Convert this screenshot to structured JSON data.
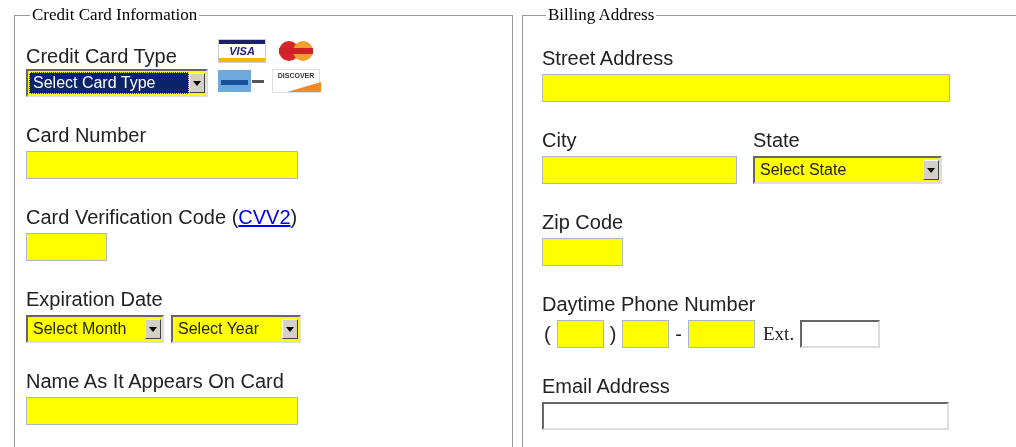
{
  "credit_card": {
    "legend": "Credit Card Information",
    "card_type": {
      "label": "Credit Card Type",
      "select": {
        "value": "Select Card Type",
        "focused": true,
        "highlighted": true
      },
      "logos": [
        {
          "kind": "visa",
          "text": "VISA"
        },
        {
          "kind": "mastercard"
        },
        {
          "kind": "amex"
        },
        {
          "kind": "discover",
          "text": "DISCOVER"
        }
      ]
    },
    "card_number": {
      "label": "Card Number",
      "highlighted": true
    },
    "cvv": {
      "label_before": "Card Verification Code (",
      "link": "CVV2",
      "label_after": ")",
      "highlighted": true
    },
    "expiration": {
      "label": "Expiration Date",
      "selects": [
        {
          "value": "Select Month",
          "focused": false,
          "highlighted": true
        },
        {
          "value": "Select Year",
          "focused": false,
          "highlighted": true
        }
      ]
    },
    "name_on_card": {
      "label": "Name As It Appears On Card",
      "highlighted": true
    }
  },
  "billing_address": {
    "legend": "Billing Address",
    "street": {
      "label": "Street Address",
      "highlighted": true
    },
    "city": {
      "label": "City",
      "highlighted": true
    },
    "state": {
      "label": "State",
      "select": {
        "value": "Select State",
        "focused": false,
        "highlighted": true
      }
    },
    "zip": {
      "label": "Zip Code",
      "highlighted": true
    },
    "phone": {
      "label": "Daytime Phone Number",
      "parts": [
        {
          "kind": "symbol",
          "text": "("
        },
        {
          "kind": "field",
          "highlighted": true
        },
        {
          "kind": "symbol",
          "text": ")"
        },
        {
          "kind": "field",
          "highlighted": true
        },
        {
          "kind": "symbol",
          "text": "-"
        },
        {
          "kind": "field",
          "highlighted": true
        },
        {
          "kind": "label",
          "text": "Ext."
        },
        {
          "kind": "field",
          "highlighted": false
        }
      ]
    },
    "email": {
      "label": "Email Address",
      "highlighted": false
    }
  }
}
